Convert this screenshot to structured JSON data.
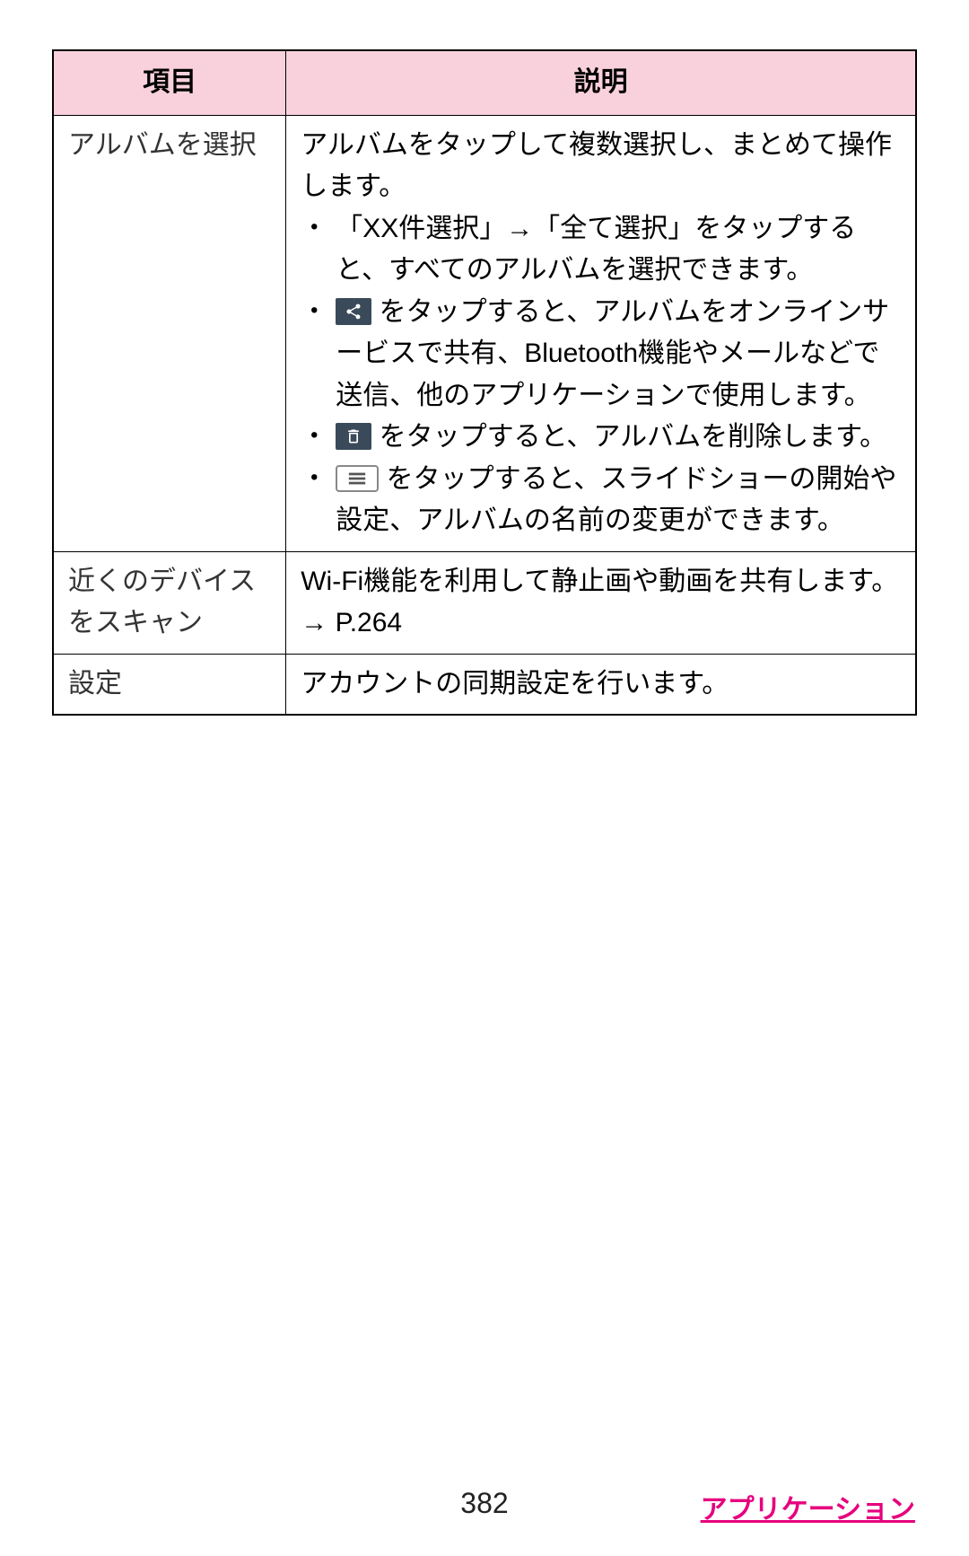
{
  "table": {
    "headers": {
      "item": "項目",
      "description": "説明"
    },
    "rows": [
      {
        "term": "アルバムを選択",
        "desc_intro": "アルバムをタップして複数選択し、まとめて操作します。",
        "bullets": [
          {
            "pre": "「XX件選択」→「全て選択」をタップすると、すべてのアルバムを選択できます。"
          },
          {
            "icon": "share",
            "post": " をタップすると、アルバムをオンラインサービスで共有、Bluetooth機能やメールなどで送信、他のアプリケーションで使用します。"
          },
          {
            "icon": "trash",
            "post": " をタップすると、アルバムを削除します。"
          },
          {
            "icon": "menu-outline",
            "post": " をタップすると、スライドショーの開始や設定、アルバムの名前の変更ができます。"
          }
        ]
      },
      {
        "term": "近くのデバイスをスキャン",
        "desc_plain": "Wi-Fi機能を利用して静止画や動画を共有します。→ P.264"
      },
      {
        "term": "設定",
        "desc_plain": "アカウントの同期設定を行います。"
      }
    ]
  },
  "footer": {
    "page": "382",
    "section": "アプリケーション"
  }
}
